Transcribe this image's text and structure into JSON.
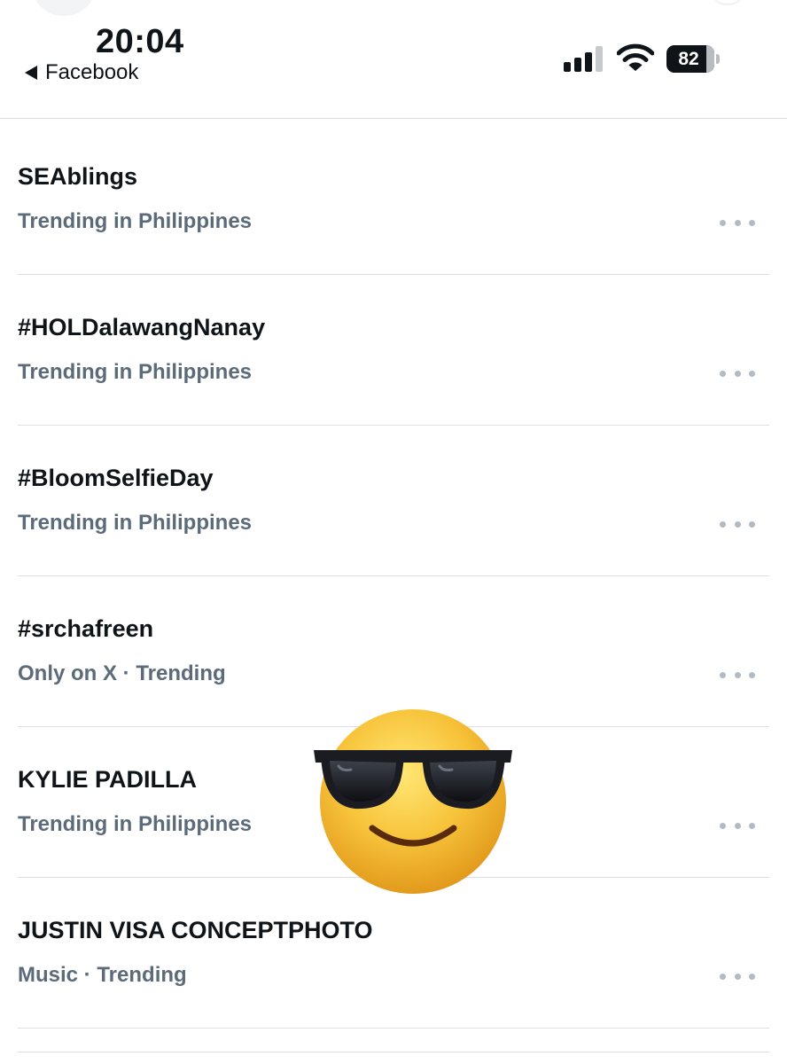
{
  "status_bar": {
    "time": "20:04",
    "back_app": "Facebook",
    "battery_level": "82",
    "icons": {
      "back": "back-caret-icon",
      "signal": "cellular-signal-icon",
      "wifi": "wifi-icon",
      "battery": "battery-icon"
    }
  },
  "trends": [
    {
      "title": "SEAblings",
      "meta": "Trending in Philippines"
    },
    {
      "title": "#HOLDalawangNanay",
      "meta": "Trending in Philippines"
    },
    {
      "title": "#BloomSelfieDay",
      "meta": "Trending in Philippines"
    },
    {
      "title": "#srchafreen",
      "meta": "Only on X · Trending"
    },
    {
      "title": "KYLIE PADILLA",
      "meta": "Trending in Philippines"
    },
    {
      "title": "JUSTIN VISA CONCEPTPHOTO",
      "meta": "Music · Trending"
    }
  ],
  "overlay": {
    "sticker": "smiling-face-with-sunglasses-emoji"
  },
  "colors": {
    "text_primary": "#0f1419",
    "text_secondary": "#5c6b7a",
    "divider": "#dcdfe3",
    "more_dots": "#b2bbc3",
    "emoji_yellow": "#f7c33a"
  }
}
